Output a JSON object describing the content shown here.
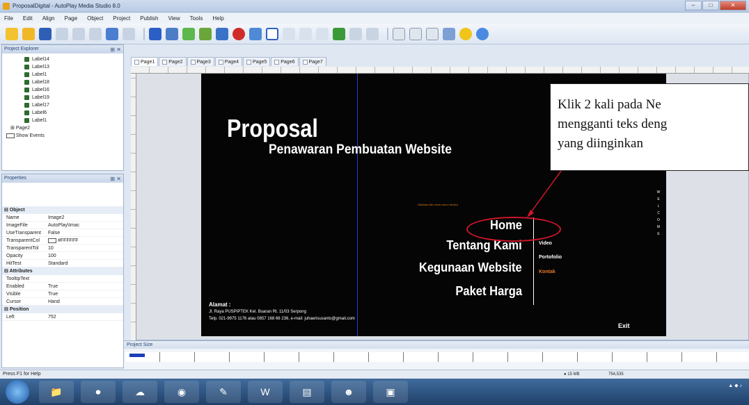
{
  "window": {
    "title": "ProposalDigital - AutoPlay Media Studio 8.0"
  },
  "menu": [
    "File",
    "Edit",
    "Align",
    "Page",
    "Object",
    "Project",
    "Publish",
    "View",
    "Tools",
    "Help"
  ],
  "project_explorer": {
    "title": "Project Explorer",
    "items": [
      "Label14",
      "Label13",
      "Label1",
      "Label18",
      "Label16",
      "Label19",
      "Label17",
      "Label6",
      "Label1"
    ],
    "page": "Page2",
    "show_events": "Show Events"
  },
  "properties": {
    "title": "Properties",
    "cat_object": "Object",
    "rows": [
      {
        "k": "Name",
        "v": "Image2"
      },
      {
        "k": "ImageFile",
        "v": "AutoPlay\\Imac"
      },
      {
        "k": "UseTransparent",
        "v": "False"
      },
      {
        "k": "TransparentCol",
        "v": "#FFFFFF"
      },
      {
        "k": "TransparentTol",
        "v": "10"
      },
      {
        "k": "Opacity",
        "v": "100"
      },
      {
        "k": "HitTest",
        "v": "Standard"
      }
    ],
    "cat_attributes": "Attributes",
    "attr_rows": [
      {
        "k": "TooltipText",
        "v": ""
      },
      {
        "k": "Enabled",
        "v": "True"
      },
      {
        "k": "Visible",
        "v": "True"
      },
      {
        "k": "Cursor",
        "v": "Hand"
      }
    ],
    "cat_position": "Position",
    "pos_rows": [
      {
        "k": "Left",
        "v": "752"
      }
    ]
  },
  "tabs": [
    "Page1",
    "Page2",
    "Page3",
    "Page4",
    "Page5",
    "Page6",
    "Page7"
  ],
  "stage": {
    "heading": "Proposal",
    "subheading": "Penawaran Pembuatan Website",
    "hint": "Silahkan klik menu-menu berikut",
    "menu": [
      "Home",
      "Tentang Kami",
      "Kegunaan Website",
      "Paket Harga"
    ],
    "submenu": [
      "Video",
      "Portofolio",
      "Kontak"
    ],
    "welcome": "WELCOME",
    "address_title": "Alamat :",
    "address_line1": "Jl. Raya PUSPIPTEK Kel. Buaran Rt. 11/03 Serpong",
    "address_line2": "Telp. 021-9975 1176 atau 0857 168 66 236, e-mail: juhaerisusanto@gmail.com",
    "exit": "Exit"
  },
  "callout": {
    "line1": "Klik 2 kali pada Ne",
    "line2": "mengganti teks deng",
    "line3": "yang diinginkan"
  },
  "project_size": {
    "title": "Project Size",
    "used_fraction": 0.02
  },
  "status": {
    "help": "Press F1 for Help",
    "mem": "15 MB",
    "coords": "754,535"
  },
  "colors": {
    "accent": "#e8792a",
    "annotation": "#d0162a"
  }
}
